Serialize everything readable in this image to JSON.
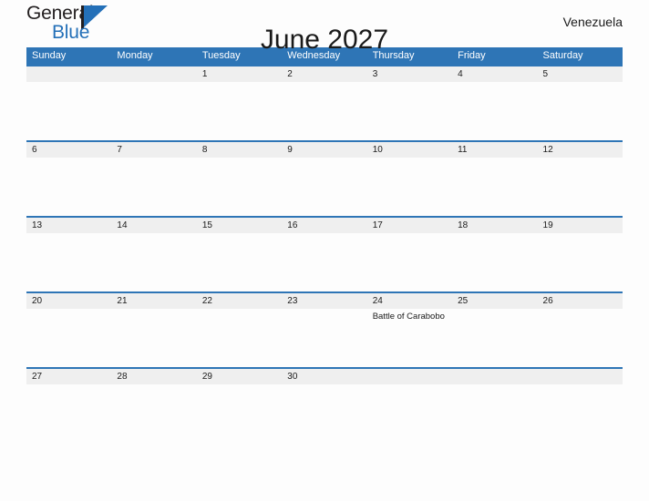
{
  "brand": {
    "name_top": "General",
    "name_bottom": "Blue",
    "logo_icon": "triangle-flag-icon",
    "color_primary": "#2470b8",
    "color_text": "#231f20"
  },
  "header": {
    "title": "June 2027",
    "region": "Venezuela"
  },
  "theme": {
    "header_blue": "#2e75b6",
    "date_band_gray": "#efefef",
    "page_background": "#fdfdfd",
    "text": "#1a1a1a"
  },
  "calendar": {
    "month": "June",
    "year": "2027",
    "weekday_headers": [
      "Sunday",
      "Monday",
      "Tuesday",
      "Wednesday",
      "Thursday",
      "Friday",
      "Saturday"
    ],
    "weeks": [
      {
        "days": [
          {
            "date": "",
            "event": ""
          },
          {
            "date": "",
            "event": ""
          },
          {
            "date": "1",
            "event": ""
          },
          {
            "date": "2",
            "event": ""
          },
          {
            "date": "3",
            "event": ""
          },
          {
            "date": "4",
            "event": ""
          },
          {
            "date": "5",
            "event": ""
          }
        ]
      },
      {
        "days": [
          {
            "date": "6",
            "event": ""
          },
          {
            "date": "7",
            "event": ""
          },
          {
            "date": "8",
            "event": ""
          },
          {
            "date": "9",
            "event": ""
          },
          {
            "date": "10",
            "event": ""
          },
          {
            "date": "11",
            "event": ""
          },
          {
            "date": "12",
            "event": ""
          }
        ]
      },
      {
        "days": [
          {
            "date": "13",
            "event": ""
          },
          {
            "date": "14",
            "event": ""
          },
          {
            "date": "15",
            "event": ""
          },
          {
            "date": "16",
            "event": ""
          },
          {
            "date": "17",
            "event": ""
          },
          {
            "date": "18",
            "event": ""
          },
          {
            "date": "19",
            "event": ""
          }
        ]
      },
      {
        "days": [
          {
            "date": "20",
            "event": ""
          },
          {
            "date": "21",
            "event": ""
          },
          {
            "date": "22",
            "event": ""
          },
          {
            "date": "23",
            "event": ""
          },
          {
            "date": "24",
            "event": "Battle of Carabobo"
          },
          {
            "date": "25",
            "event": ""
          },
          {
            "date": "26",
            "event": ""
          }
        ]
      },
      {
        "days": [
          {
            "date": "27",
            "event": ""
          },
          {
            "date": "28",
            "event": ""
          },
          {
            "date": "29",
            "event": ""
          },
          {
            "date": "30",
            "event": ""
          },
          {
            "date": "",
            "event": ""
          },
          {
            "date": "",
            "event": ""
          },
          {
            "date": "",
            "event": ""
          }
        ]
      }
    ]
  }
}
